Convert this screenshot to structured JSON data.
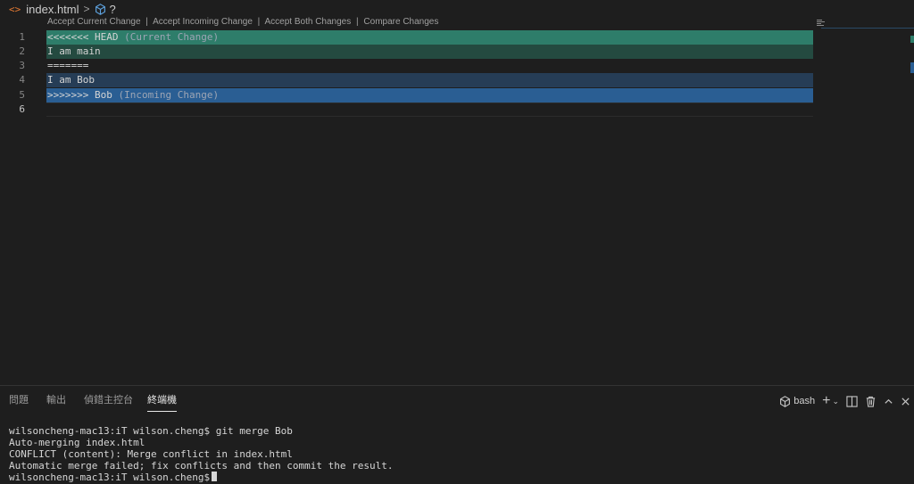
{
  "breadcrumb": {
    "file_icon": "html-file-icon",
    "file": "index.html",
    "symbol": "?"
  },
  "codelens": {
    "accept_current": "Accept Current Change",
    "accept_incoming": "Accept Incoming Change",
    "accept_both": "Accept Both Changes",
    "compare": "Compare Changes",
    "separator": "|"
  },
  "editor": {
    "lines": [
      {
        "num": "1",
        "text": "<<<<<<< HEAD",
        "hint": " (Current Change)"
      },
      {
        "num": "2",
        "text": "I am main",
        "hint": ""
      },
      {
        "num": "3",
        "text": "=======",
        "hint": ""
      },
      {
        "num": "4",
        "text": "I am Bob",
        "hint": ""
      },
      {
        "num": "5",
        "text": ">>>>>>> Bob",
        "hint": " (Incoming Change)"
      },
      {
        "num": "6",
        "text": "",
        "hint": ""
      }
    ]
  },
  "panel": {
    "tabs": [
      "問題",
      "輸出",
      "偵錯主控台",
      "終端機"
    ],
    "active_tab": "終端機",
    "terminal_shell": "bash"
  },
  "terminal": {
    "lines": [
      "wilsoncheng-mac13:iT wilson.cheng$ git merge Bob",
      "Auto-merging index.html",
      "CONFLICT (content): Merge conflict in index.html",
      "Automatic merge failed; fix conflicts and then commit the result.",
      "wilsoncheng-mac13:iT wilson.cheng$"
    ]
  },
  "colors": {
    "current_header": "#2e7d6a",
    "current_body": "#244a40",
    "incoming_body": "#263d56",
    "incoming_header": "#2a5e93"
  }
}
